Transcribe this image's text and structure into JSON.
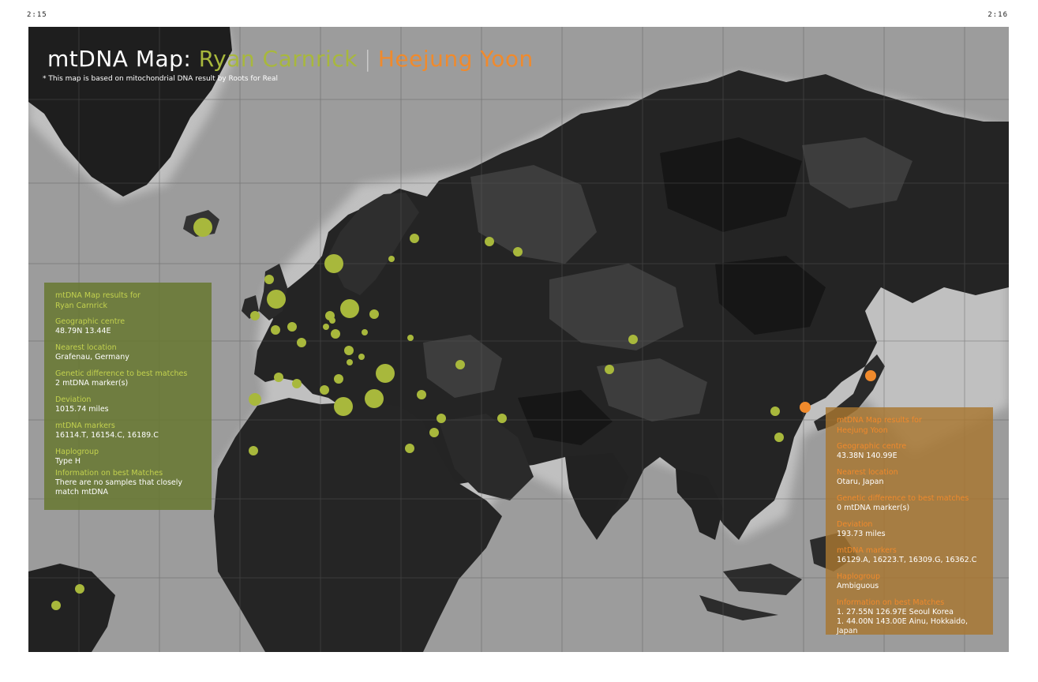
{
  "page_numbers": {
    "left": "2:15",
    "right": "2:16"
  },
  "title": {
    "prefix": "mtDNA Map:",
    "person1": "Ryan Carnrick",
    "separator": "|",
    "person2": "Heejung Yoon"
  },
  "note": "* This map is based on mitochondrial DNA result by Roots for Real",
  "colors": {
    "person1": "#a8b83c",
    "person2": "#f08a2c",
    "land": "#262626",
    "ocean": "#9a9a9a"
  },
  "panels": {
    "ryan": {
      "heading_line1": "mtDNA Map results for",
      "heading_line2": "Ryan Carnrick",
      "geo_label": "Geographic centre",
      "geo_value": "48.79N 13.44E",
      "nearest_label": "Nearest location",
      "nearest_value": "Grafenau, Germany",
      "diff_label": "Genetic difference to best matches",
      "diff_value": "2 mtDNA marker(s)",
      "dev_label": "Deviation",
      "dev_value": "1015.74 miles",
      "markers_label": "mtDNA markers",
      "markers_value": "16114.T, 16154.C, 16189.C",
      "hap_label": "Haplogroup",
      "hap_value": "Type H",
      "info_label": "Information on best Matches",
      "info_line1": "There are no samples that closely",
      "info_line2": "match mtDNA"
    },
    "heejung": {
      "heading_line1": "mtDNA Map results for",
      "heading_line2": "Heejung Yoon",
      "geo_label": "Geographic centre",
      "geo_value": "43.38N 140.99E",
      "nearest_label": "Nearest location",
      "nearest_value": "Otaru, Japan",
      "diff_label": "Genetic difference to best matches",
      "diff_value": "0 mtDNA marker(s)",
      "dev_label": "Deviation",
      "dev_value": "193.73 miles",
      "markers_label": "mtDNA markers",
      "markers_value": "16129.A, 16223.T, 16309.G, 16362.C",
      "hap_label": "Haplogroup",
      "hap_value": "Ambiguous",
      "info_label": "Information on best Matches",
      "info_line1": "1. 27.55N 126.97E Seoul Korea",
      "info_line2": "1. 44.00N 143.00E Ainu, Hokkaido, Japan"
    }
  }
}
